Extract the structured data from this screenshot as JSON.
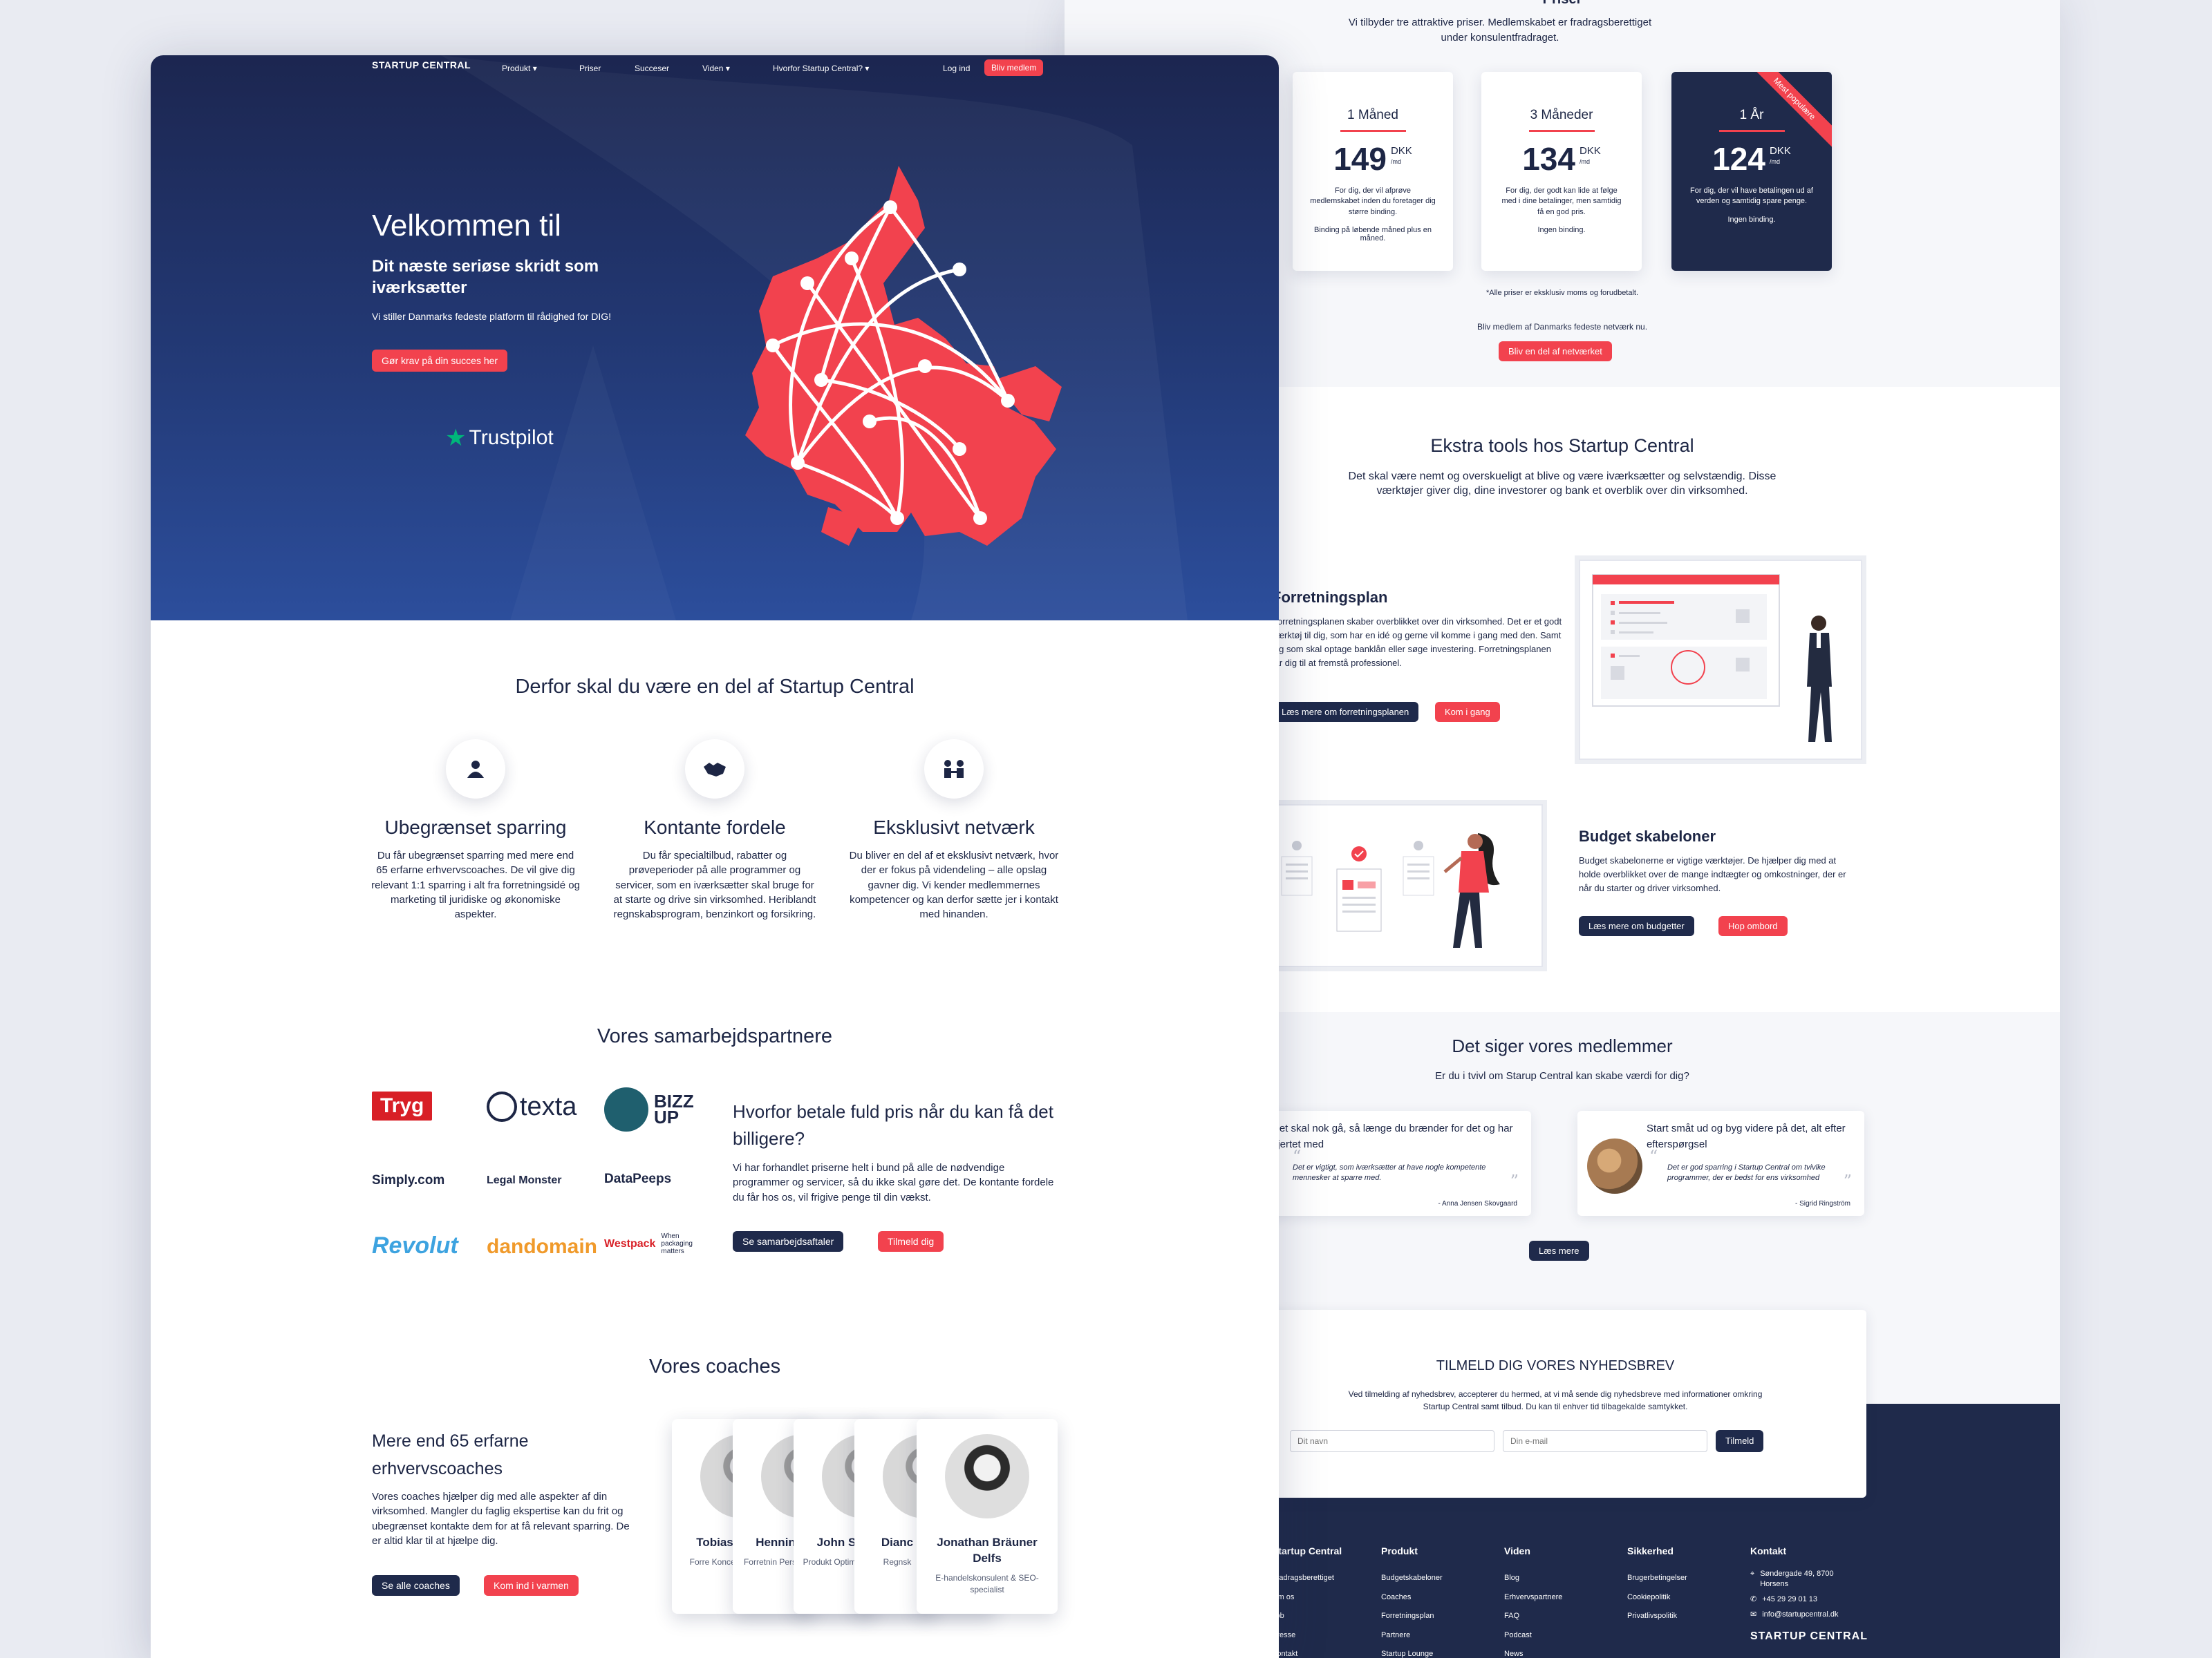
{
  "pricing": {
    "top_title": "Priser",
    "intro": "Vi tilbyder tre attraktive priser. Medlemskabet er fradragsberettiget under konsulentfradraget.",
    "plans": [
      {
        "title": "1 Måned",
        "price": "149",
        "currency": "DKK",
        "unit": "/md",
        "desc": "For dig, der vil afprøve medlemskabet inden du foretager dig større binding.",
        "binding": "Binding på løbende måned plus en måned."
      },
      {
        "title": "3 Måneder",
        "price": "134",
        "currency": "DKK",
        "unit": "/md",
        "desc": "For dig, der godt kan lide at følge med i dine betalinger, men samtidig få en god pris.",
        "binding": "Ingen binding."
      },
      {
        "title": "1 År",
        "price": "124",
        "currency": "DKK",
        "unit": "/md",
        "desc": "For dig, der vil have betalingen ud af verden og samtidig spare penge.",
        "binding": "Ingen binding.",
        "ribbon": "Mest populære"
      }
    ],
    "footnote": "*Alle priser er eksklusiv moms og forudbetalt.",
    "cta_text": "Bliv medlem af Danmarks fedeste netværk nu.",
    "cta_button": "Bliv en del af netværket"
  },
  "tools": {
    "title": "Ekstra tools hos Startup Central",
    "subtitle": "Det skal være nemt og overskueligt at blive og være iværksætter og selvstændig. Disse værktøjer giver dig, dine investorer og bank et overblik over din virksomhed.",
    "plan_title": "Forretningsplan",
    "plan_desc": "Forretningsplanen skaber overblikket over din virksomhed. Det er et godt værktøj til dig, som har en idé og gerne vil komme i gang med den. Samt dig som skal optage banklån eller søge investering. Forretningsplanen får dig til at fremstå professionel.",
    "plan_btn1": "Læs mere om forretningsplanen",
    "plan_btn2": "Kom i gang",
    "budget_title": "Budget skabeloner",
    "budget_desc": "Budget skabelonerne er vigtige værktøjer. De hjælper dig med at holde overblikket over de mange indtægter og omkostninger, der er når du starter og driver virksomhed.",
    "budget_btn1": "Læs mere om budgetter",
    "budget_btn2": "Hop ombord"
  },
  "testimonials": {
    "title": "Det siger vores medlemmer",
    "subtitle": "Er du i tvivl om Starup Central kan skabe værdi for dig?",
    "items": [
      {
        "heading": "Det skal nok gå, så længe du brænder for det og har hjertet med",
        "quote": "Det er vigtigt, som iværksætter at have nogle kompetente mennesker at sparre med.",
        "author": "- Anna Jensen Skovgaard"
      },
      {
        "heading": "Start småt ud og byg videre på det, alt efter efterspørgsel",
        "quote": "Det er god sparring i Startup Central om tvivlke programmer, der er bedst for ens virksomhed",
        "author": "- Sigrid Ringström"
      }
    ],
    "more_btn": "Læs mere"
  },
  "newsletter": {
    "title": "TILMELD DIG VORES NYHEDSBREV",
    "text": "Ved tilmelding af nyhedsbrev, accepterer du hermed, at vi må sende dig nyhedsbreve med informationer omkring Startup Central samt tilbud. Du kan til enhver tid tilbagekalde samtykket.",
    "name_placeholder": "Dit navn",
    "email_placeholder": "Din e-mail",
    "button": "Tilmeld"
  },
  "footer": {
    "col1": {
      "title": "Startup Central",
      "items": [
        "Fradragsberettiget",
        "Om os",
        "Job",
        "Presse",
        "Kontakt"
      ]
    },
    "col2": {
      "title": "Produkt",
      "items": [
        "Budgetskabeloner",
        "Coaches",
        "Forretningsplan",
        "Partnere",
        "Startup Lounge"
      ]
    },
    "col3": {
      "title": "Viden",
      "items": [
        "Blog",
        "Erhvervspartnere",
        "FAQ",
        "Podcast",
        "News"
      ]
    },
    "col4": {
      "title": "Sikkerhed",
      "items": [
        "Brugerbetingelser",
        "Cookiepolitik",
        "Privatlivspolitik"
      ]
    },
    "col5": {
      "title": "Kontakt",
      "address": "Søndergade 49, 8700 Horsens",
      "phone": "+45 29 29 01 13",
      "email": "info@startupcentral.dk"
    },
    "logo": "STARTUP CENTRAL"
  },
  "nav": {
    "logo": "STARTUP CENTRAL",
    "items": [
      "Produkt",
      "Priser",
      "Succeser",
      "Viden",
      "Hvorfor Startup Central?"
    ],
    "login": "Log ind",
    "cta": "Bliv medlem"
  },
  "hero": {
    "title": "Velkommen til",
    "subtitle": "Dit næste seriøse skridt som iværksætter",
    "tagline": "Vi stiller Danmarks fedeste platform til rådighed for DIG!",
    "button": "Gør krav på din succes her",
    "trustpilot": "Trustpilot"
  },
  "why": {
    "title": "Derfor skal du være en del af Startup Central",
    "items": [
      {
        "title": "Ubegrænset sparring",
        "desc": "Du får ubegrænset sparring med mere end 65 erfarne erhvervscoaches. De vil give dig relevant 1:1 sparring i alt fra forretningsidé og marketing til juridiske og økonomiske aspekter."
      },
      {
        "title": "Kontante fordele",
        "desc": "Du får specialtilbud, rabatter og prøveperioder på alle programmer og servicer, som en iværksætter skal bruge for at starte og drive sin virksomhed. Heriblandt regnskabsprogram, benzinkort og forsikring."
      },
      {
        "title": "Eksklusivt netværk",
        "desc": "Du bliver en del af et eksklusivt netværk, hvor der er fokus på videndeling – alle opslag gavner dig. Vi kender medlemmernes kompetencer og kan derfor sætte jer i kontakt med hinanden."
      }
    ]
  },
  "partners": {
    "title": "Vores samarbejdspartnere",
    "logos": [
      "Tryg",
      "texta",
      "BIZZ UP",
      "Simply.com",
      "Legal Monster",
      "DataPeeps",
      "Revolut",
      "dandomain",
      "Westpack",
      "When packaging matters"
    ],
    "heading": "Hvorfor betale fuld pris når du kan få det billigere?",
    "text": "Vi har forhandlet priserne helt i bund på alle de nødvendige programmer og servicer, så du ikke skal gøre det. De kontante fordele du får hos os, vil frigive penge til din vækst.",
    "btn1": "Se samarbejdsaftaler",
    "btn2": "Tilmeld dig"
  },
  "coaches": {
    "title": "Vores coaches",
    "heading": "Mere end 65 erfarne erhvervscoaches",
    "text": "Vores coaches hjælper dig med alle aspekter af din virksomhed. Mangler du faglig ekspertise kan du frit og ubegrænset kontakte dem for at få relevant sparring. De er altid klar til at hjælpe dig.",
    "btn1": "Se alle coaches",
    "btn2": "Kom ind i varmen",
    "cards": [
      {
        "name": "Tobias",
        "role": "Forre Koncep"
      },
      {
        "name": "Hennin",
        "role": "Forretnin Personl"
      },
      {
        "name": "John S",
        "role": "Produkt Optimerin"
      },
      {
        "name": "Dianc",
        "role": "Regnsk"
      },
      {
        "name": "Jonathan Bräuner Delfs",
        "role": "E-handelskonsulent & SEO-specialist"
      }
    ]
  },
  "colors": {
    "navy": "#1d2645",
    "red": "#f2424e",
    "hero_start": "#1c2650",
    "hero_end": "#2c4e9c"
  },
  "icons": [
    "user-icon",
    "handshake-icon",
    "network-icon",
    "star-icon",
    "location-icon",
    "phone-icon",
    "mail-icon",
    "rocket-icon",
    "chevron-down-icon"
  ]
}
